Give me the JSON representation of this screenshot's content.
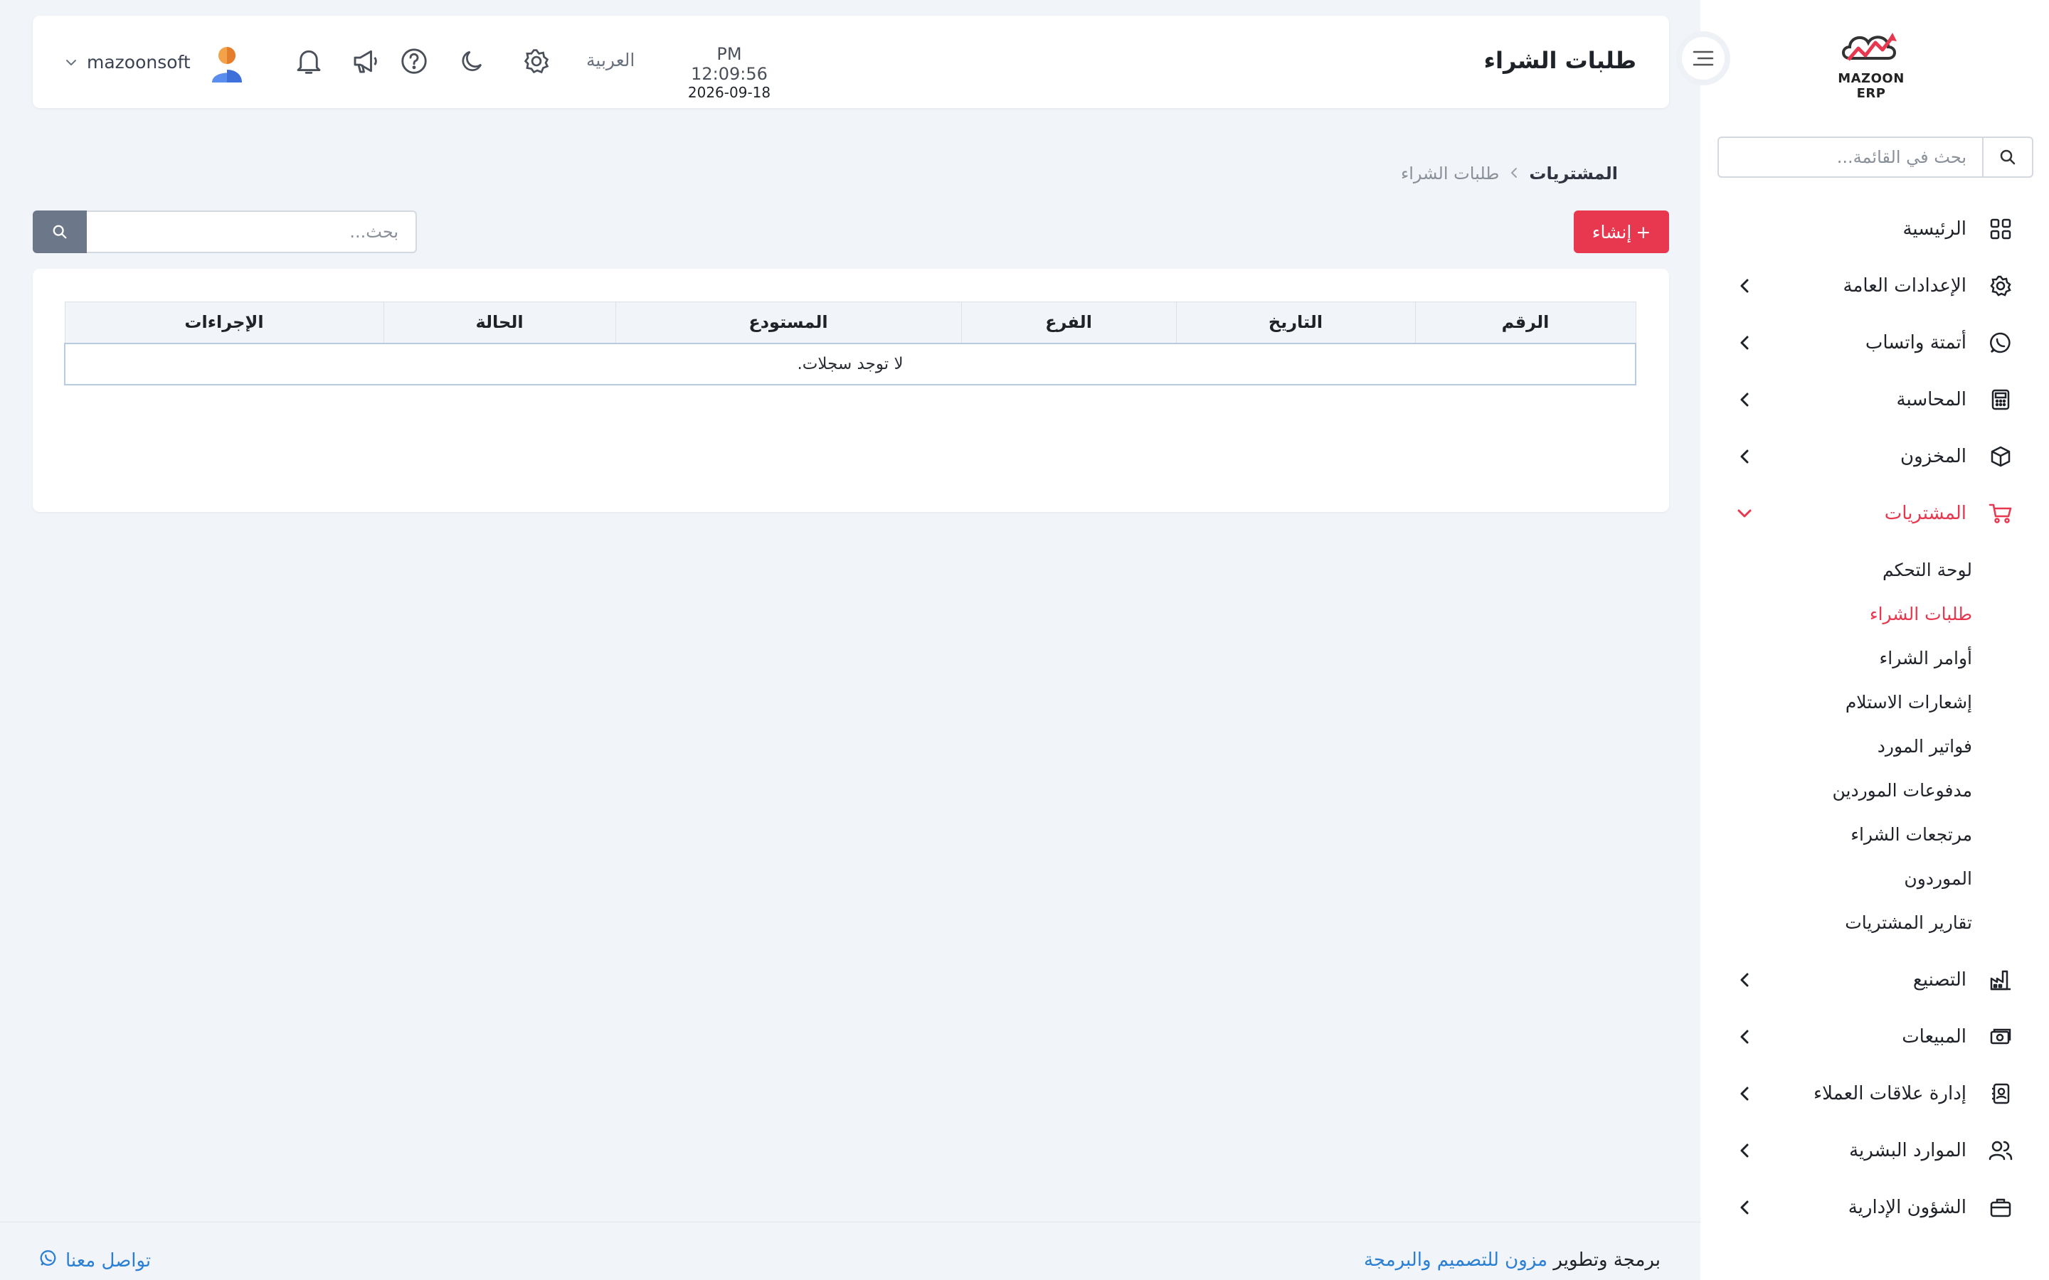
{
  "app": {
    "logo_text": "MAZOON ERP"
  },
  "sidebar": {
    "search_placeholder": "بحث في القائمة...",
    "items": [
      {
        "label": "الرئيسية",
        "icon": "grid-icon"
      },
      {
        "label": "الإعدادات العامة",
        "icon": "gear-icon"
      },
      {
        "label": "أتمتة واتساب",
        "icon": "whatsapp-icon"
      },
      {
        "label": "المحاسبة",
        "icon": "calculator-icon"
      },
      {
        "label": "المخزون",
        "icon": "box-icon"
      },
      {
        "label": "المشتريات",
        "icon": "cart-icon"
      },
      {
        "label": "التصنيع",
        "icon": "factory-icon"
      },
      {
        "label": "المبيعات",
        "icon": "cash-icon"
      },
      {
        "label": "إدارة علاقات العملاء",
        "icon": "contacts-icon"
      },
      {
        "label": "الموارد البشرية",
        "icon": "users-icon"
      },
      {
        "label": "الشؤون الإدارية",
        "icon": "briefcase-icon"
      }
    ],
    "purchases_sub": [
      {
        "label": "لوحة التحكم"
      },
      {
        "label": "طلبات الشراء"
      },
      {
        "label": "أوامر الشراء"
      },
      {
        "label": "إشعارات الاستلام"
      },
      {
        "label": "فواتير المورد"
      },
      {
        "label": "مدفوعات الموردين"
      },
      {
        "label": "مرتجعات الشراء"
      },
      {
        "label": "الموردون"
      },
      {
        "label": "تقارير المشتريات"
      }
    ]
  },
  "header": {
    "title": "طلبات الشراء",
    "time": "PM 12:09:56",
    "date": "2026-09-18",
    "language": "العربية",
    "username": "mazoonsoft"
  },
  "breadcrumb": {
    "parent": "المشتريات",
    "current": "طلبات الشراء"
  },
  "toolbar": {
    "create_label": "إنشاء",
    "create_plus": "+",
    "search_placeholder": "بحث..."
  },
  "table": {
    "columns": [
      "الرقم",
      "التاريخ",
      "الفرع",
      "المستودع",
      "الحالة",
      "الإجراءات"
    ],
    "empty_message": "لا توجد سجلات."
  },
  "footer": {
    "credit_prefix": "برمجة وتطوير",
    "credit_link": "مزون للتصميم والبرمجة",
    "contact_label": "تواصل معنا"
  },
  "colors": {
    "accent": "#e8384f",
    "link": "#2a7fd4",
    "background": "#f1f4f8"
  }
}
